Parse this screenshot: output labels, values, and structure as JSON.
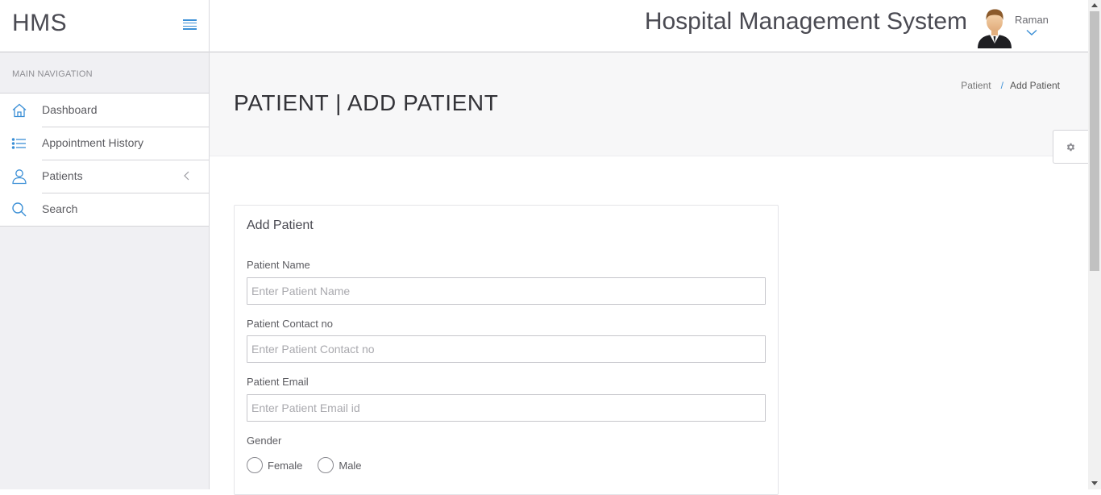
{
  "brand": {
    "name": "HMS"
  },
  "header": {
    "title": "Hospital Management System",
    "user_name": "Raman"
  },
  "sidebar": {
    "heading": "MAIN NAVIGATION",
    "items": [
      {
        "label": "Dashboard",
        "icon": "home-icon"
      },
      {
        "label": "Appointment History",
        "icon": "list-icon"
      },
      {
        "label": "Patients",
        "icon": "user-icon"
      },
      {
        "label": "Search",
        "icon": "search-icon"
      }
    ]
  },
  "page": {
    "title": "PATIENT | ADD PATIENT",
    "breadcrumb": [
      "Patient",
      "Add Patient"
    ]
  },
  "form": {
    "title": "Add Patient",
    "fields": [
      {
        "label": "Patient Name",
        "placeholder": "Enter Patient Name",
        "value": ""
      },
      {
        "label": "Patient Contact no",
        "placeholder": "Enter Patient Contact no",
        "value": ""
      },
      {
        "label": "Patient Email",
        "placeholder": "Enter Patient Email id",
        "value": ""
      }
    ],
    "gender": {
      "label": "Gender",
      "options": [
        "Female",
        "Male"
      ],
      "selected": null
    }
  },
  "colors": {
    "accent": "#3b8fd6",
    "sidebar_bg": "#f0f0f3",
    "title_band_bg": "#f7f7f8"
  }
}
